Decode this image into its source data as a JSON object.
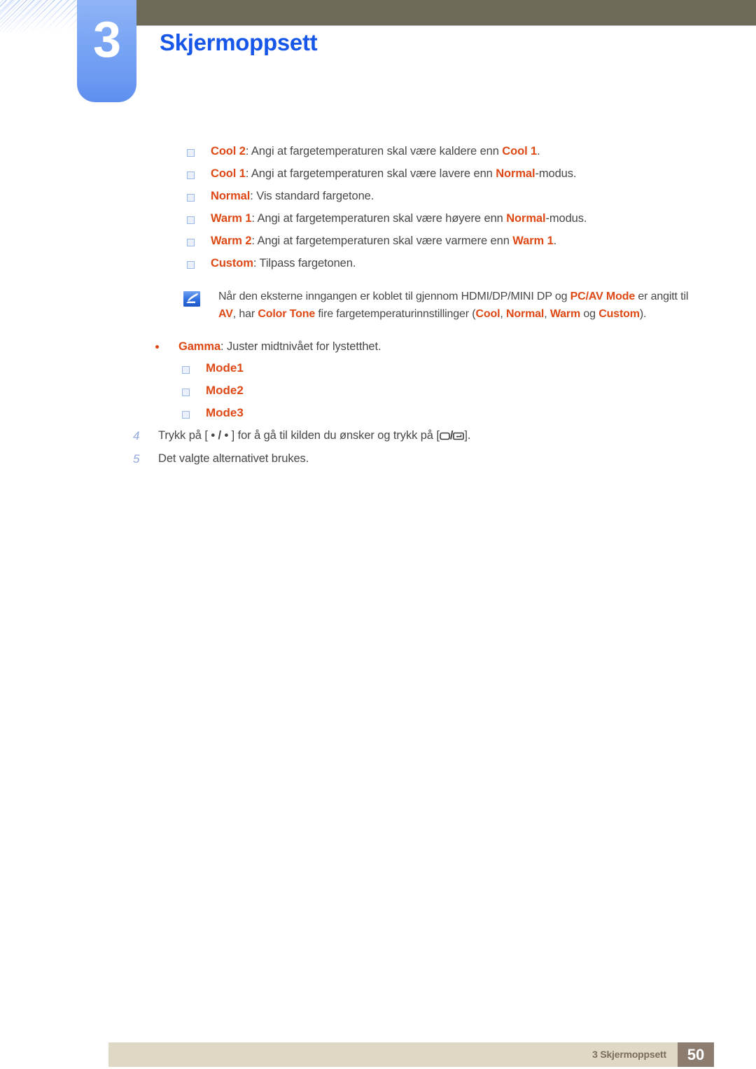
{
  "header": {
    "chapter_number": "3",
    "chapter_title": "Skjermoppsett"
  },
  "color_tone_options": [
    {
      "term": "Cool 2",
      "text_before": ": Angi at fargetemperaturen skal være kaldere enn ",
      "term2": "Cool 1",
      "text_after": "."
    },
    {
      "term": "Cool 1",
      "text_before": ": Angi at fargetemperaturen skal være lavere enn ",
      "term2": "Normal",
      "text_after": "-modus."
    },
    {
      "term": "Normal",
      "text_before": ": Vis standard fargetone.",
      "term2": "",
      "text_after": ""
    },
    {
      "term": "Warm 1",
      "text_before": ": Angi at fargetemperaturen skal være høyere enn ",
      "term2": "Normal",
      "text_after": "-modus."
    },
    {
      "term": "Warm 2",
      "text_before": ": Angi at fargetemperaturen skal være varmere enn ",
      "term2": "Warm 1",
      "text_after": "."
    },
    {
      "term": "Custom",
      "text_before": ": Tilpass fargetonen.",
      "term2": "",
      "text_after": ""
    }
  ],
  "note": {
    "icon": "note-pencil-icon",
    "segment_1": "Når den eksterne inngangen er koblet til gjennom HDMI/DP/MINI DP og ",
    "highlight_1": "PC/AV Mode",
    "segment_2": " er angitt til ",
    "highlight_2": "AV",
    "segment_3": ", har ",
    "highlight_3": "Color Tone",
    "segment_4": " fire fargetemperaturinnstillinger (",
    "highlight_4": "Cool",
    "segment_5": ", ",
    "highlight_5": "Normal",
    "segment_6": ", ",
    "highlight_6": "Warm",
    "segment_7": " og ",
    "highlight_7": "Custom",
    "segment_8": ")."
  },
  "gamma": {
    "term": "Gamma",
    "description": ": Juster midtnivået for lystetthet.",
    "modes": [
      "Mode1",
      "Mode2",
      "Mode3"
    ]
  },
  "steps": [
    {
      "number": "4",
      "text_before": "Trykk på [ ",
      "arrow_glyph_1": "•",
      "text_mid_1": " / ",
      "arrow_glyph_2": "•",
      "text_mid_2": " ] for å gå til kilden du ønsker og trykk på [",
      "key_glyph_1": "source-button-icon",
      "text_mid_3": "/",
      "key_glyph_2": "enter-button-icon",
      "text_after": "]."
    },
    {
      "number": "5",
      "text_before": "Det valgte alternativet brukes.",
      "arrow_glyph_1": "",
      "text_mid_1": "",
      "arrow_glyph_2": "",
      "text_mid_2": "",
      "key_glyph_1": "",
      "text_mid_3": "",
      "key_glyph_2": "",
      "text_after": ""
    }
  ],
  "footer": {
    "text": "3 Skjermoppsett",
    "page_number": "50"
  },
  "colors": {
    "accent_orange": "#dd4814",
    "title_blue": "#1656e8",
    "tab_blue": "#7ba6f5",
    "header_olive": "#6d6b57",
    "footer_beige": "#ded8c5",
    "page_box_brown": "#8d7d70",
    "body_text": "#474747",
    "step_number_blue": "#8fa8dd"
  }
}
